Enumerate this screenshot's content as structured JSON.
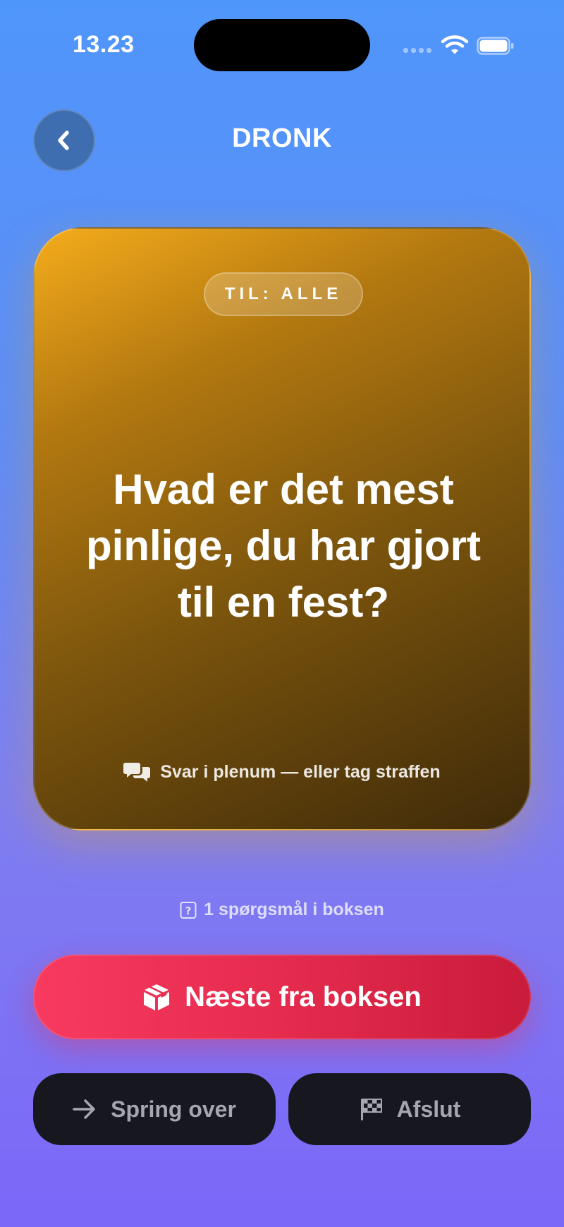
{
  "status_bar": {
    "time": "13.23",
    "icons": [
      "cellular-signal-icon",
      "wifi-icon",
      "battery-icon"
    ]
  },
  "header": {
    "back_icon": "chevron-left-icon",
    "title": "DRONK"
  },
  "card": {
    "target_label": "TIL: ALLE",
    "question": "Hvad er det mest pinlige, du har gjort til en fest?",
    "hint_icon": "speech-bubbles-icon",
    "hint": "Svar i plenum — eller tag straffen"
  },
  "counter": {
    "icon": "question-square-icon",
    "text": "1 spørgsmål i boksen"
  },
  "buttons": {
    "next": {
      "icon": "box-icon",
      "label": "Næste fra boksen"
    },
    "skip": {
      "icon": "arrow-right-icon",
      "label": "Spring over"
    },
    "quit": {
      "icon": "checkered-flag-icon",
      "label": "Afslut"
    }
  },
  "colors": {
    "background_top": "#4f96fb",
    "background_bottom": "#7b67f8",
    "card_start": "#f5ac1c",
    "card_end": "#3f2a09",
    "primary_button": "#e52b4e",
    "secondary_button": "#17181f"
  }
}
